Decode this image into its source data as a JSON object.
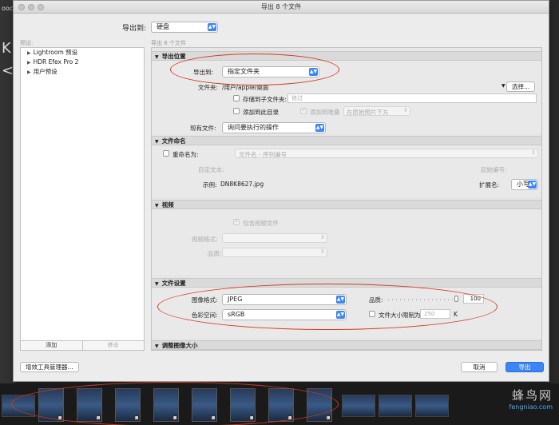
{
  "window": {
    "title": "导出 8 个文件"
  },
  "destination": {
    "label": "导出到:",
    "value": "硬盘"
  },
  "presets": {
    "label": "预设:",
    "items": [
      "Lightroom 预设",
      "HDR Efex Pro 2",
      "用户预设"
    ],
    "add": "添加",
    "remove": "移去"
  },
  "file_count_label": "导出 8 个文件",
  "export_location": {
    "header": "导出位置",
    "export_to_label": "导出到:",
    "export_to_value": "指定文件夹",
    "folder_label": "文件夹:",
    "folder_path": "/用户/apple/桌面",
    "choose": "选择...",
    "subfolder_label": "存储到子文件夹:",
    "subfolder_value": "修过",
    "add_catalog_label": "添加到此目录",
    "add_stack_label": "添加到堆叠",
    "stack_position": "在原始照片下方",
    "existing_label": "现有文件:",
    "existing_value": "询问要执行的操作"
  },
  "file_naming": {
    "header": "文件命名",
    "rename_label": "重命名为:",
    "rename_value": "文件名 - 序列编号",
    "custom_text_label": "自定文本:",
    "start_number_label": "起始编号:",
    "example_label": "示例:",
    "example_value": "DN8K8627.jpg",
    "extension_label": "扩展名:",
    "extension_value": "小写"
  },
  "video": {
    "header": "视频",
    "include_label": "包含视频文件",
    "format_label": "视频格式:",
    "quality_label": "品质:"
  },
  "file_settings": {
    "header": "文件设置",
    "format_label": "图像格式:",
    "format_value": "JPEG",
    "quality_label": "品质:",
    "quality_value": "100",
    "quality_level": 1.0,
    "colorspace_label": "色彩空间:",
    "colorspace_value": "sRGB",
    "limit_label": "文件大小限制为:",
    "limit_value": "250",
    "limit_unit": "K"
  },
  "resize": {
    "header": "调整图像大小"
  },
  "footer": {
    "plugin_manager": "增效工具管理器...",
    "cancel": "取消",
    "export": "导出"
  },
  "left_bg_glyphs": [
    "ooc",
    "K",
    "<"
  ],
  "watermark": {
    "big": "蜂鸟网",
    "small": "fengniao.com"
  },
  "colors": {
    "accent": "#3b86f7",
    "annotation": "#d23b1e"
  }
}
